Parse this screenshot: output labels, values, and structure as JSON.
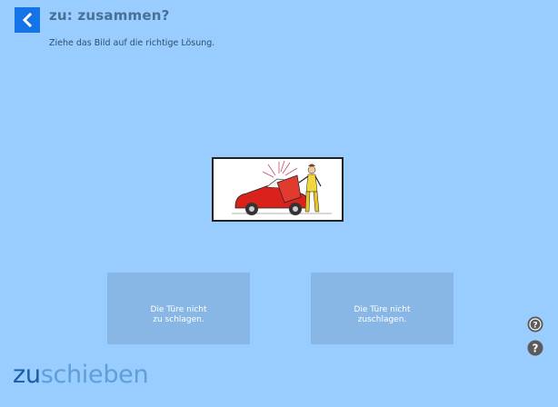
{
  "header": {
    "back_icon": "chevron-left-icon",
    "title": "zu: zusammen?",
    "instruction": "Ziehe das Bild auf die richtige Lösung."
  },
  "drag_item": {
    "image_desc": "car-door-illustration"
  },
  "answers": [
    {
      "label": "Die Türe nicht\nzu schlagen."
    },
    {
      "label": "Die Türe nicht\nzuschlagen."
    }
  ],
  "footer": {
    "logo_part1": "zu",
    "logo_part2": "schieben",
    "help_icons": [
      "audio-help-icon",
      "question-help-icon"
    ]
  },
  "colors": {
    "background": "#99ccff",
    "accent": "#1473e6",
    "answer_box": "#88b7e5",
    "logo_dark": "#1a5ea8",
    "logo_light": "#5e9fd8"
  }
}
